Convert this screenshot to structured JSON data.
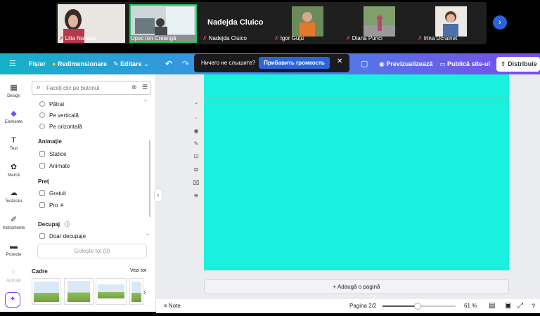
{
  "call": {
    "tiles": [
      {
        "name": "Lilia Nahaba",
        "muted": true
      },
      {
        "name": "Upsc Ion Creangă",
        "muted": false
      },
      {
        "name": "Nadejda Cluico",
        "muted": true
      },
      {
        "name": "Igor Guțu",
        "muted": true
      },
      {
        "name": "Diana Purici",
        "muted": true
      },
      {
        "name": "Irina Ucrainet",
        "muted": true
      }
    ],
    "speaker": "Nadejda Cluico",
    "next_icon": "chevron-right-icon"
  },
  "toolbar": {
    "menu_icon": "hamburger-icon",
    "file": "Fișier",
    "resize": "Redimensionare",
    "edit": "Editare",
    "preview": "Previzualizează",
    "publish": "Publică site-ul",
    "share": "Distribuie"
  },
  "notice": {
    "text": "Ничего не слышите?",
    "button": "Прибавить громкость"
  },
  "rail": [
    {
      "label": "Design",
      "icon": "layout-icon"
    },
    {
      "label": "Elemente",
      "icon": "shapes-icon"
    },
    {
      "label": "Text",
      "icon": "text-icon"
    },
    {
      "label": "Marcă",
      "icon": "brand-icon"
    },
    {
      "label": "Încărcări",
      "icon": "upload-icon"
    },
    {
      "label": "Instrumente",
      "icon": "tools-icon"
    },
    {
      "label": "Proiecte",
      "icon": "folder-icon"
    },
    {
      "label": "Aplicații",
      "icon": "apps-icon"
    }
  ],
  "panel": {
    "search_placeholder": "Faceți clic pe butonul",
    "orientation": [
      "Pătrat",
      "Pe verticală",
      "Pe orizontală"
    ],
    "animation_title": "Animație",
    "animation": [
      "Statice",
      "Animate"
    ],
    "price_title": "Preț",
    "price": [
      "Gratuit",
      "Pro ✳"
    ],
    "cutout_title": "Decupaj",
    "cutout": [
      "Doar decupaje"
    ],
    "clear_all": "Golește tot (0)",
    "frames_title": "Cadre",
    "see_all": "Vezi tot"
  },
  "canvas": {
    "page_color": "#1af0de",
    "add_page": "Adaugă o pagină"
  },
  "bottom": {
    "notes": "Note",
    "page_indicator": "Pagina 2/2",
    "zoom_level": 0.61,
    "zoom": "61 %"
  },
  "colors": {
    "accent": "#7a4ce8",
    "blue": "#2b65d9",
    "toolbar_start": "#14b1c6",
    "toolbar_end": "#7a4ce8"
  }
}
